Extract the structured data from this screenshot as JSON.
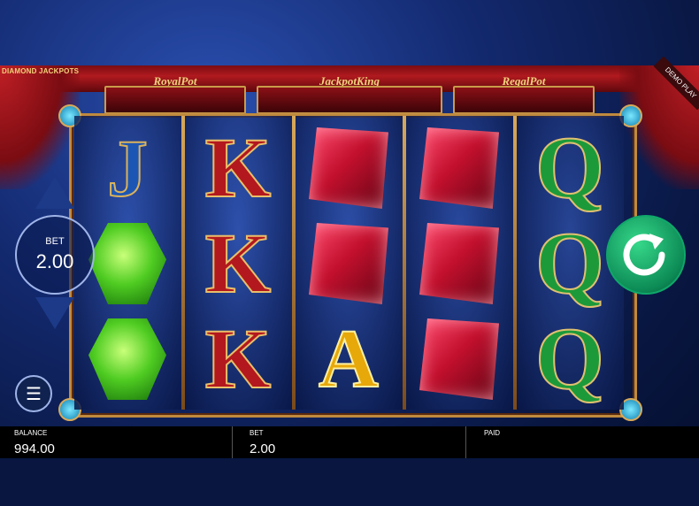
{
  "game": {
    "brand": "DIAMOND JACKPOTS",
    "demo_label": "DEMO PLAY"
  },
  "jackpots": [
    {
      "name": "RoyalPot",
      "value": ""
    },
    {
      "name": "JackpotKing",
      "value": ""
    },
    {
      "name": "RegalPot",
      "value": ""
    }
  ],
  "reels": [
    [
      "J",
      "emerald",
      "emerald"
    ],
    [
      "K",
      "K",
      "K"
    ],
    [
      "ruby",
      "ruby",
      "A"
    ],
    [
      "ruby",
      "ruby",
      "ruby"
    ],
    [
      "Q",
      "Q",
      "Q"
    ]
  ],
  "controls": {
    "bet_label": "BET",
    "bet_value": "2.00",
    "bet_up_icon": "triangle-up-icon",
    "bet_down_icon": "triangle-down-icon",
    "menu_icon": "hamburger-icon",
    "spin_icon": "spin-arrow-icon"
  },
  "footer": {
    "balance_label": "BALANCE",
    "balance_value": "994.00",
    "bet_label": "BET",
    "bet_value": "2.00",
    "paid_label": "PAID",
    "paid_value": ""
  },
  "colors": {
    "spin_button": "#0c8a55",
    "ruby": "#c3102e",
    "emerald": "#4fcc22",
    "frame_gold": "#c08a3e"
  }
}
